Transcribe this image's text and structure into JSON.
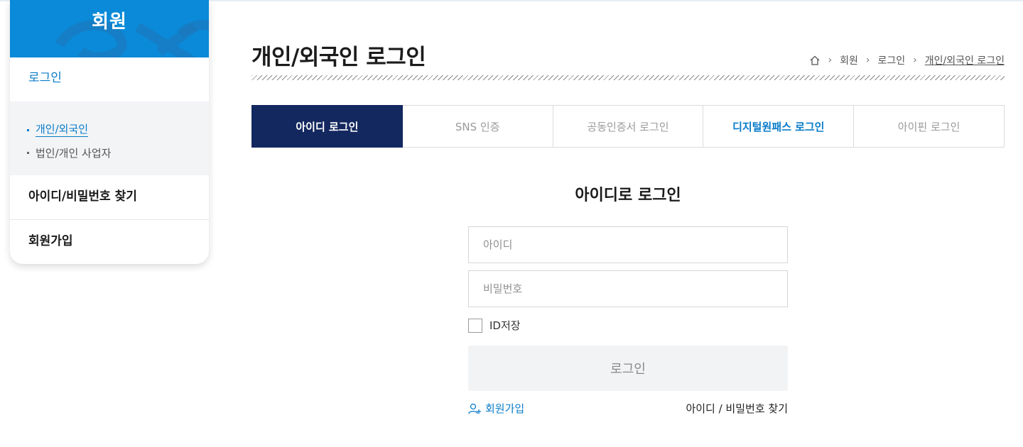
{
  "sidebar": {
    "title": "회원",
    "items": [
      {
        "label": "로그인"
      },
      {
        "label": "아이디/비밀번호 찾기"
      },
      {
        "label": "회원가입"
      }
    ],
    "subitems": [
      {
        "label": "개인/외국인"
      },
      {
        "label": "법인/개인 사업자"
      }
    ]
  },
  "header": {
    "title": "개인/외국인 로그인",
    "breadcrumb": [
      "회원",
      "로그인",
      "개인/외국인 로그인"
    ]
  },
  "tabs": [
    {
      "label": "아이디 로그인"
    },
    {
      "label": "SNS 인증"
    },
    {
      "label": "공동인증서 로그인"
    },
    {
      "label": "디지털원패스 로그인"
    },
    {
      "label": "아이핀 로그인"
    }
  ],
  "form": {
    "title": "아이디로 로그인",
    "id_placeholder": "아이디",
    "pw_placeholder": "비밀번호",
    "save_id_label": "ID저장",
    "login_button": "로그인",
    "join_link": "회원가입",
    "find_link": "아이디 / 비밀번호 찾기"
  },
  "colors": {
    "brand_blue": "#0a8ad8",
    "active_tab_navy": "#13285f",
    "link_blue": "#0a7cc9"
  },
  "icons": [
    "home-icon",
    "chevron-right-icon",
    "user-add-icon"
  ]
}
